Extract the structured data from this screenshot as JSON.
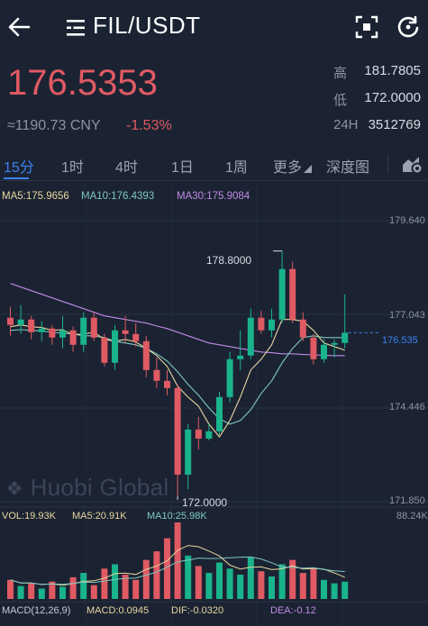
{
  "header": {
    "back_icon": "arrow-left-icon",
    "menu_icon": "menu-icon",
    "pair": "FIL/USDT",
    "scan_icon": "scan-icon",
    "refresh_icon": "refresh-icon"
  },
  "ticker": {
    "last_price": "176.5353",
    "cny": "≈1190.73 CNY",
    "change": "-1.53%",
    "high_label": "高",
    "high": "181.7805",
    "low_label": "低",
    "low": "172.0000",
    "vol_label": "24H",
    "vol": "3512769"
  },
  "tabs": [
    {
      "label": "15分",
      "active": true
    },
    {
      "label": "1时"
    },
    {
      "label": "4时"
    },
    {
      "label": "1日"
    },
    {
      "label": "1周"
    },
    {
      "label": "更多"
    },
    {
      "label": "深度图"
    }
  ],
  "indicators": {
    "ma5": "MA5:175.9656",
    "ma10": "MA10:176.4393",
    "ma30": "MA30:175.9084"
  },
  "price_axis": [
    "179.640",
    "177.043",
    "174.446",
    "171.850"
  ],
  "current_price_tag": "176.535",
  "max_label": "178.8000",
  "min_label": "172.0000",
  "watermark": "Huobi Global",
  "volume": {
    "vol": "VOL:19.93K",
    "ma5": "MA5:20.91K",
    "ma10": "MA10:25.98K",
    "axis_max": "88.24K"
  },
  "macd": {
    "params": "MACD(12,26,9)",
    "macd": "MACD:0.0945",
    "dif": "DIF:-0.0320",
    "dea": "DEA:-0.12"
  },
  "colors": {
    "up": "#19b38c",
    "down": "#e05a63",
    "ma5": "#e8d6a0",
    "ma10": "#7ec8c0",
    "ma30": "#c08ae6",
    "accent": "#3d82f0"
  },
  "chart_data": {
    "type": "candlestick",
    "candles_ohlc": [
      [
        176.95,
        177.25,
        176.45,
        176.75
      ],
      [
        176.75,
        177.3,
        176.5,
        176.9
      ],
      [
        176.9,
        177.0,
        176.35,
        176.55
      ],
      [
        176.55,
        176.85,
        176.3,
        176.65
      ],
      [
        176.65,
        176.75,
        176.2,
        176.4
      ],
      [
        176.4,
        177.0,
        176.1,
        176.6
      ],
      [
        176.6,
        176.7,
        176.0,
        176.2
      ],
      [
        176.2,
        177.1,
        176.0,
        176.95
      ],
      [
        176.95,
        177.1,
        176.3,
        176.4
      ],
      [
        176.4,
        176.5,
        175.6,
        175.7
      ],
      [
        175.7,
        176.75,
        175.5,
        176.6
      ],
      [
        176.6,
        177.0,
        176.25,
        176.5
      ],
      [
        176.5,
        176.8,
        176.15,
        176.3
      ],
      [
        176.3,
        176.45,
        175.3,
        175.5
      ],
      [
        175.5,
        175.85,
        175.0,
        175.2
      ],
      [
        175.2,
        175.5,
        174.8,
        175.0
      ],
      [
        175.0,
        175.1,
        172.0,
        172.6
      ],
      [
        172.6,
        174.0,
        172.2,
        173.85
      ],
      [
        173.85,
        174.2,
        173.3,
        173.6
      ],
      [
        173.6,
        174.0,
        173.55,
        173.8
      ],
      [
        173.8,
        174.9,
        173.7,
        174.75
      ],
      [
        174.75,
        176.0,
        174.6,
        175.8
      ],
      [
        175.8,
        176.6,
        175.5,
        175.9
      ],
      [
        175.9,
        177.2,
        175.8,
        176.95
      ],
      [
        176.95,
        177.15,
        176.5,
        176.6
      ],
      [
        176.6,
        177.2,
        176.4,
        176.9
      ],
      [
        176.9,
        178.8,
        176.8,
        178.3
      ],
      [
        178.3,
        178.5,
        176.8,
        176.9
      ],
      [
        176.9,
        177.1,
        176.3,
        176.4
      ],
      [
        176.4,
        176.5,
        175.65,
        175.8
      ],
      [
        175.8,
        176.35,
        175.7,
        176.2
      ],
      [
        176.2,
        176.35,
        175.85,
        176.25
      ],
      [
        176.25,
        177.6,
        176.1,
        176.535
      ]
    ],
    "ma5": [
      176.7,
      176.75,
      176.7,
      176.68,
      176.6,
      176.62,
      176.48,
      176.5,
      176.55,
      176.35,
      176.3,
      176.35,
      176.28,
      176.1,
      175.9,
      175.6,
      175.05,
      174.75,
      174.5,
      174.0,
      173.65,
      174.1,
      174.75,
      175.5,
      175.8,
      176.2,
      176.9,
      176.9,
      176.85,
      176.6,
      176.25,
      176.15,
      176.05
    ],
    "ma10": [
      176.6,
      176.62,
      176.6,
      176.58,
      176.55,
      176.52,
      176.5,
      176.45,
      176.45,
      176.4,
      176.3,
      176.25,
      176.2,
      176.1,
      175.95,
      175.75,
      175.45,
      175.1,
      174.8,
      174.45,
      174.15,
      174.0,
      174.1,
      174.4,
      174.85,
      175.2,
      175.7,
      176.1,
      176.4,
      176.45,
      176.4,
      176.4,
      176.4
    ],
    "ma30": [
      177.9,
      177.8,
      177.7,
      177.6,
      177.5,
      177.4,
      177.3,
      177.2,
      177.1,
      177.0,
      176.95,
      176.9,
      176.85,
      176.8,
      176.72,
      176.65,
      176.55,
      176.45,
      176.35,
      176.25,
      176.2,
      176.15,
      176.1,
      176.05,
      176.0,
      175.98,
      175.95,
      175.95,
      175.93,
      175.92,
      175.91,
      175.9,
      175.9
    ],
    "volumes": [
      22,
      15,
      18,
      12,
      20,
      14,
      25,
      30,
      16,
      35,
      40,
      28,
      22,
      45,
      55,
      70,
      88.24,
      50,
      38,
      30,
      42,
      35,
      28,
      48,
      32,
      26,
      40,
      45,
      30,
      35,
      22,
      18,
      19.93
    ],
    "ylim": [
      171.85,
      179.64
    ],
    "max_price": 178.8,
    "min_price": 172.0
  }
}
